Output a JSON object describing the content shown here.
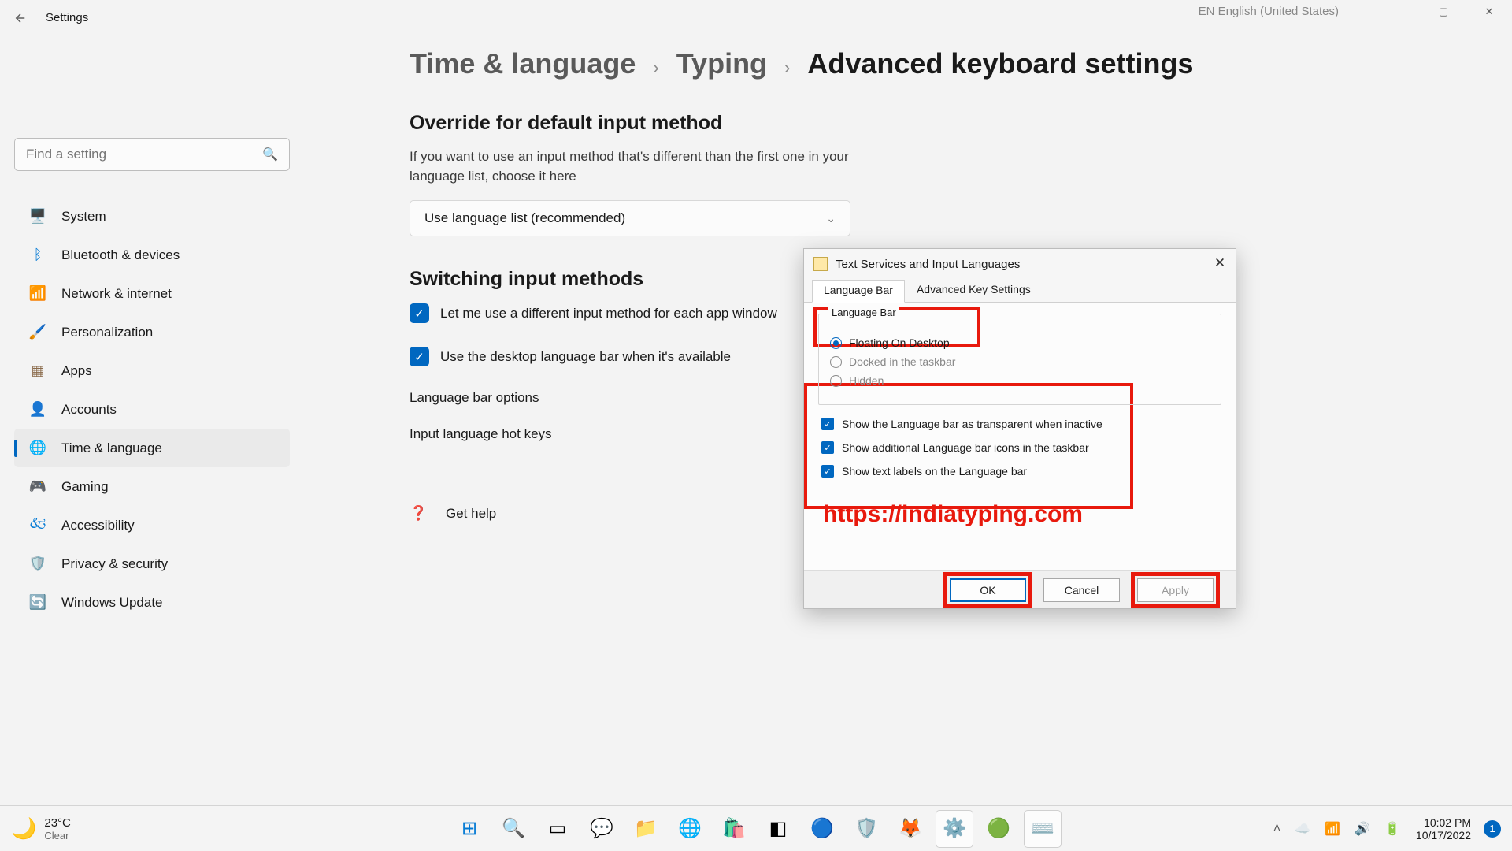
{
  "titlebar": {
    "app": "Settings",
    "lang_indicator": "EN English (United States)"
  },
  "search": {
    "placeholder": "Find a setting"
  },
  "nav": [
    {
      "label": "System",
      "icon": "🖥️",
      "color": "#0078d4"
    },
    {
      "label": "Bluetooth & devices",
      "icon": "ᚼ",
      "color": "#0078d4"
    },
    {
      "label": "Network & internet",
      "icon": "📶",
      "color": "#0078d4"
    },
    {
      "label": "Personalization",
      "icon": "🖌️",
      "color": "#d97a2f"
    },
    {
      "label": "Apps",
      "icon": "▦",
      "color": "#8a6a4a"
    },
    {
      "label": "Accounts",
      "icon": "👤",
      "color": "#2aa05a"
    },
    {
      "label": "Time & language",
      "icon": "🌐",
      "color": "#0078d4",
      "active": true
    },
    {
      "label": "Gaming",
      "icon": "🎮",
      "color": "#8a8a8a"
    },
    {
      "label": "Accessibility",
      "icon": "♿",
      "color": "#0078d4"
    },
    {
      "label": "Privacy & security",
      "icon": "🛡️",
      "color": "#8a8a8a"
    },
    {
      "label": "Windows Update",
      "icon": "🔄",
      "color": "#0078d4"
    }
  ],
  "breadcrumb": {
    "a": "Time & language",
    "b": "Typing",
    "current": "Advanced keyboard settings"
  },
  "main": {
    "section1_title": "Override for default input method",
    "section1_desc": "If you want to use an input method that's different than the first one in your language list, choose it here",
    "dropdown_value": "Use language list (recommended)",
    "section2_title": "Switching input methods",
    "check1": "Let me use a different input method for each app window",
    "check2": "Use the desktop language bar when it's available",
    "link1": "Language bar options",
    "link2": "Input language hot keys",
    "help": "Get help"
  },
  "dialog": {
    "title": "Text Services and Input Languages",
    "tab1": "Language Bar",
    "tab2": "Advanced Key Settings",
    "group_title": "Language Bar",
    "radio1": "Floating On Desktop",
    "radio2": "Docked in the taskbar",
    "radio3": "Hidden",
    "chk1": "Show the Language bar as transparent when inactive",
    "chk2": "Show additional Language bar icons in the taskbar",
    "chk3": "Show text labels on the Language bar",
    "watermark": "https://indiatyping.com",
    "btn_ok": "OK",
    "btn_cancel": "Cancel",
    "btn_apply": "Apply"
  },
  "taskbar": {
    "weather_temp": "23°C",
    "weather_cond": "Clear",
    "time": "10:02 PM",
    "date": "10/17/2022",
    "notif_count": "1"
  }
}
